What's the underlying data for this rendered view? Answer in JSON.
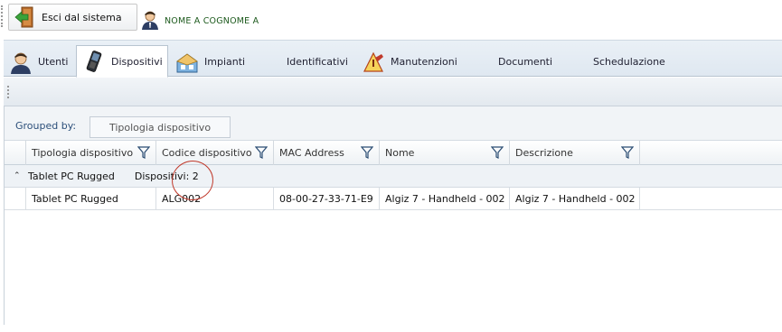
{
  "topbar": {
    "exit_label": "Esci dal sistema",
    "user_name": "NOME A COGNOME A"
  },
  "tabs": [
    {
      "label": "Utenti",
      "icon": "user-icon"
    },
    {
      "label": "Dispositivi",
      "icon": "handheld-icon",
      "active": true
    },
    {
      "label": "Impianti",
      "icon": "building-icon"
    },
    {
      "label": "Identificativi",
      "icon": ""
    },
    {
      "label": "Manutenzioni",
      "icon": "maintenance-icon"
    },
    {
      "label": "Documenti",
      "icon": ""
    },
    {
      "label": "Schedulazione",
      "icon": ""
    }
  ],
  "grid": {
    "grouped_by_label": "Grouped by:",
    "group_chip": "Tipologia dispositivo",
    "columns": [
      "Tipologia dispositivo",
      "Codice dispositivo",
      "MAC Address",
      "Nome",
      "Descrizione"
    ],
    "group_row": {
      "name": "Tablet PC Rugged",
      "count_text": "Dispositivi: 2"
    },
    "rows": [
      [
        "Tablet PC Rugged",
        "ALG002",
        "08-00-27-33-71-E9",
        "Algiz 7 - Handheld - 002",
        "Algiz 7 - Handheld - 002"
      ]
    ]
  },
  "colors": {
    "tab_bar": "#dfe8f1",
    "user_text": "#1d5a1d",
    "annotation": "#c0392b"
  }
}
